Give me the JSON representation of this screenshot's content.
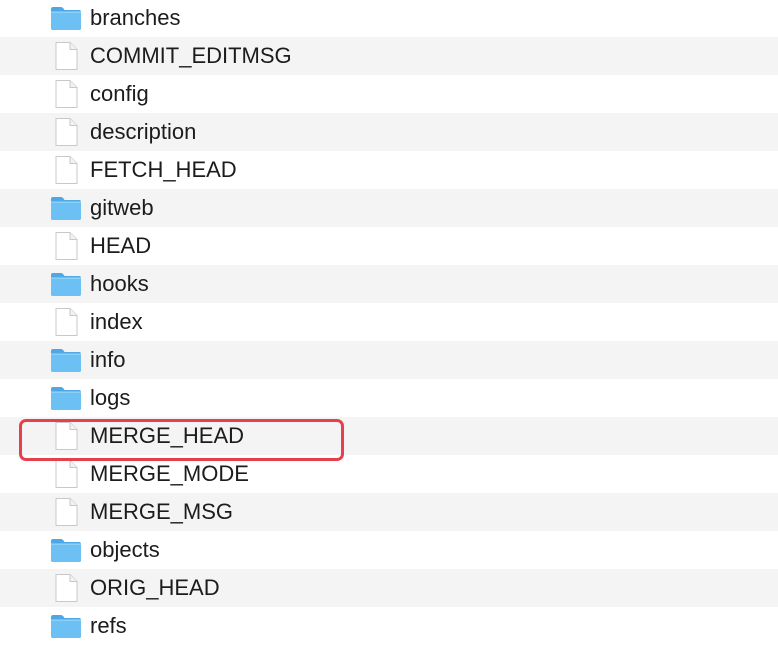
{
  "accent": {
    "folder_color": "#63b8ee",
    "highlight_color": "#e5404b",
    "alt_row_color": "#f4f4f4"
  },
  "highlighted_item": "MERGE_HEAD",
  "items": [
    {
      "name": "branches",
      "kind": "folder",
      "icon": "folder-icon"
    },
    {
      "name": "COMMIT_EDITMSG",
      "kind": "file",
      "icon": "file-icon"
    },
    {
      "name": "config",
      "kind": "file",
      "icon": "file-icon"
    },
    {
      "name": "description",
      "kind": "file",
      "icon": "file-icon"
    },
    {
      "name": "FETCH_HEAD",
      "kind": "file",
      "icon": "file-icon"
    },
    {
      "name": "gitweb",
      "kind": "folder",
      "icon": "folder-icon"
    },
    {
      "name": "HEAD",
      "kind": "file",
      "icon": "file-icon"
    },
    {
      "name": "hooks",
      "kind": "folder",
      "icon": "folder-icon"
    },
    {
      "name": "index",
      "kind": "file",
      "icon": "file-icon"
    },
    {
      "name": "info",
      "kind": "folder",
      "icon": "folder-icon"
    },
    {
      "name": "logs",
      "kind": "folder",
      "icon": "folder-icon"
    },
    {
      "name": "MERGE_HEAD",
      "kind": "file",
      "icon": "file-icon"
    },
    {
      "name": "MERGE_MODE",
      "kind": "file",
      "icon": "file-icon"
    },
    {
      "name": "MERGE_MSG",
      "kind": "file",
      "icon": "file-icon"
    },
    {
      "name": "objects",
      "kind": "folder",
      "icon": "folder-icon"
    },
    {
      "name": "ORIG_HEAD",
      "kind": "file",
      "icon": "file-icon"
    },
    {
      "name": "refs",
      "kind": "folder",
      "icon": "folder-icon"
    }
  ]
}
